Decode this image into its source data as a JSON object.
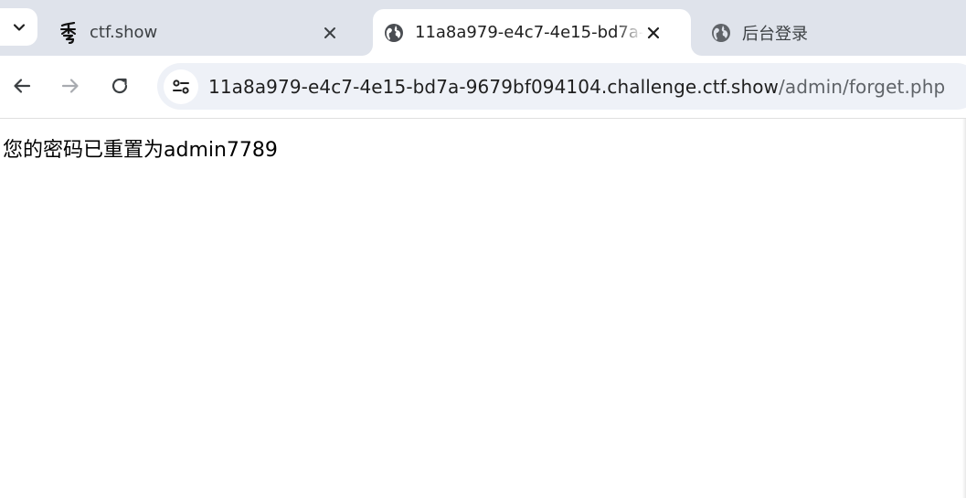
{
  "tabs": [
    {
      "title": "ctf.show",
      "icon": "ctfshow-logo-icon",
      "active": false,
      "closable": true
    },
    {
      "title": "11a8a979-e4c7-4e15-bd7a-9679bf094104.challenge.ctf.show/admin/forget.php",
      "icon": "globe-icon",
      "active": true,
      "closable": true
    },
    {
      "title": "后台登录",
      "icon": "globe-icon",
      "active": false,
      "closable": false
    }
  ],
  "toolbar": {
    "url_host": "11a8a979-e4c7-4e15-bd7a-9679bf094104.challenge.ctf.show",
    "url_path": "/admin/forget.php"
  },
  "page": {
    "message": "您的密码已重置为admin7789"
  },
  "colors": {
    "tabstrip_bg": "#dfe3eb",
    "omnibox_bg": "#eef1f7",
    "text": "#1f1f1f"
  }
}
